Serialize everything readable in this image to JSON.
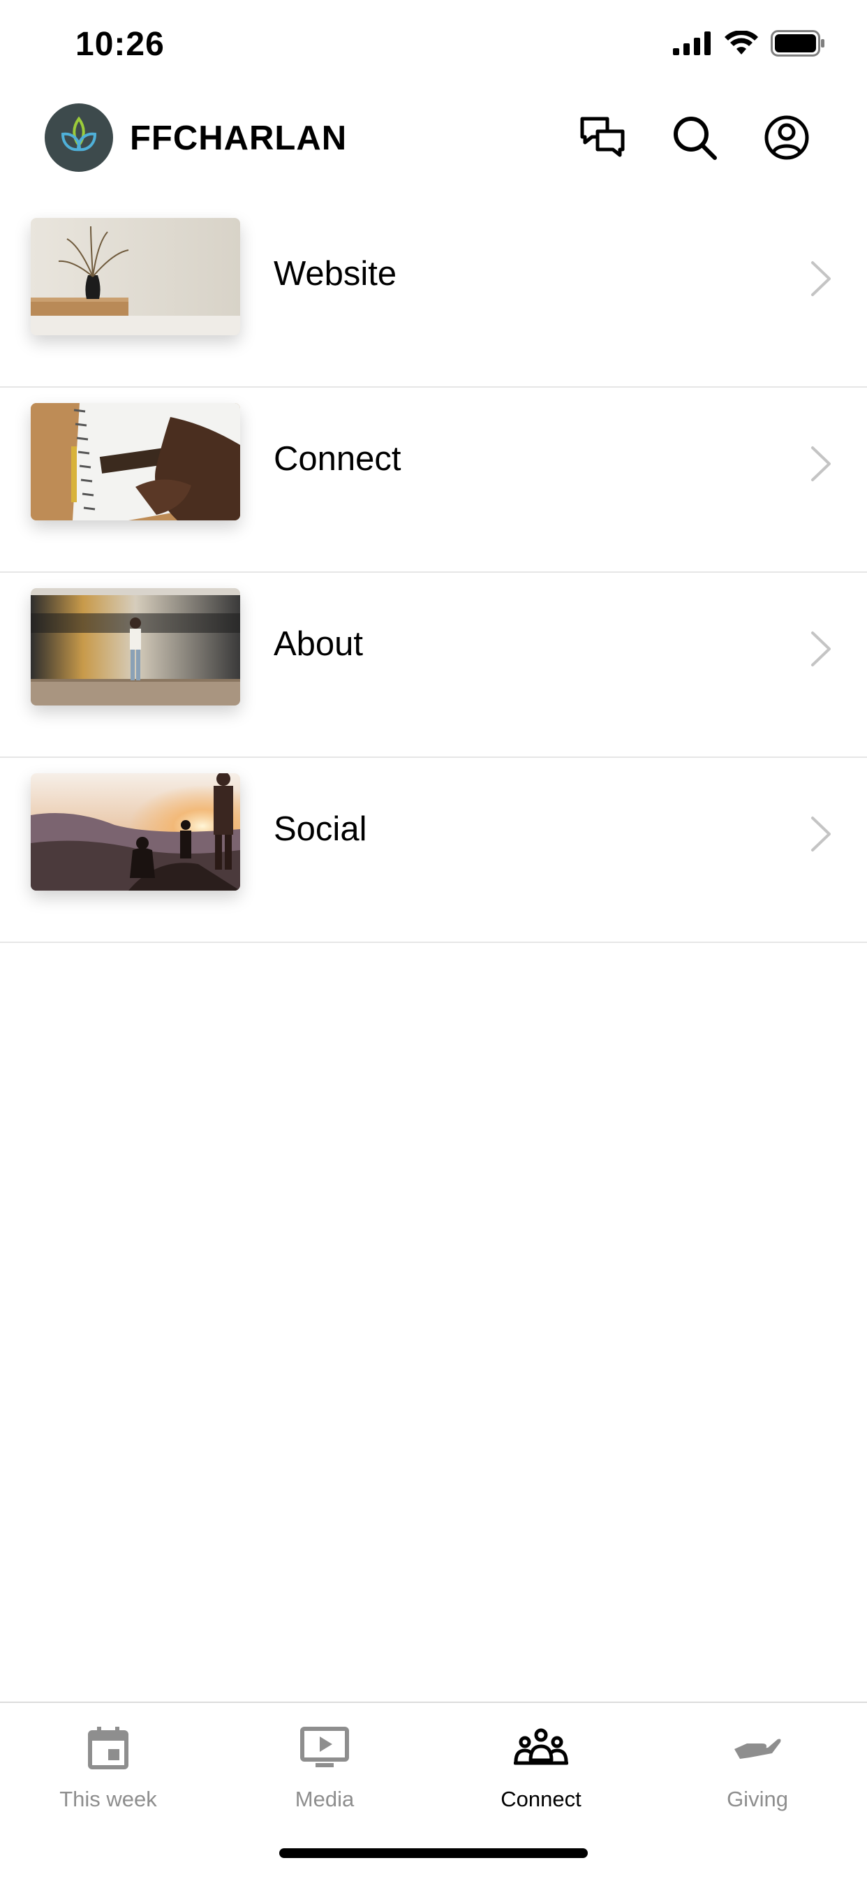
{
  "status_bar": {
    "time": "10:26"
  },
  "header": {
    "title": "FFCHARLAN",
    "icons": [
      "chat-icon",
      "search-icon",
      "profile-icon"
    ]
  },
  "list": {
    "items": [
      {
        "label": "Website"
      },
      {
        "label": "Connect"
      },
      {
        "label": "About"
      },
      {
        "label": "Social"
      }
    ]
  },
  "tab_bar": {
    "tabs": [
      {
        "label": "This week",
        "icon": "calendar-icon",
        "active": false
      },
      {
        "label": "Media",
        "icon": "play-screen-icon",
        "active": false
      },
      {
        "label": "Connect",
        "icon": "people-icon",
        "active": true
      },
      {
        "label": "Giving",
        "icon": "giving-hand-icon",
        "active": false
      }
    ],
    "active_color": "#000000",
    "inactive_color": "#8e8e8e"
  },
  "colors": {
    "logo_background": "#3d4a4c",
    "divider": "#e6e6e6"
  }
}
